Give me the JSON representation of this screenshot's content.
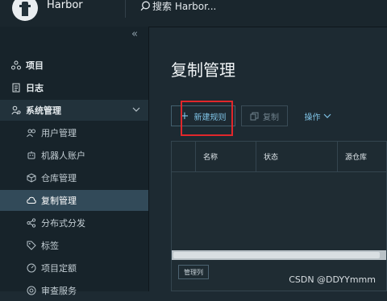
{
  "header": {
    "brand": "Harbor",
    "search_placeholder": "搜索 Harbor..."
  },
  "sidebar": {
    "items": [
      {
        "label": "项目",
        "icon": "projects-icon"
      },
      {
        "label": "日志",
        "icon": "logs-icon"
      },
      {
        "label": "系统管理",
        "icon": "system-admin-icon",
        "expanded": true
      },
      {
        "label": "用户管理",
        "icon": "users-icon"
      },
      {
        "label": "机器人账户",
        "icon": "robot-icon"
      },
      {
        "label": "仓库管理",
        "icon": "registry-icon"
      },
      {
        "label": "复制管理",
        "icon": "replication-icon",
        "active": true
      },
      {
        "label": "分布式分发",
        "icon": "distribution-icon"
      },
      {
        "label": "标签",
        "icon": "tag-icon"
      },
      {
        "label": "项目定额",
        "icon": "quota-icon"
      },
      {
        "label": "审查服务",
        "icon": "scanner-icon"
      }
    ]
  },
  "main": {
    "title": "复制管理",
    "toolbar": {
      "new_rule": "新建规则",
      "copy": "复制",
      "actions": "操作"
    },
    "table": {
      "columns": [
        "",
        "名称",
        "状态",
        "源仓库"
      ],
      "column_manager": "管理列"
    }
  },
  "watermark": "CSDN @DDYYmmm",
  "colors": {
    "accent": "#7fc3e6",
    "highlight_box": "#e1272b",
    "active_nav": "#324a59"
  }
}
